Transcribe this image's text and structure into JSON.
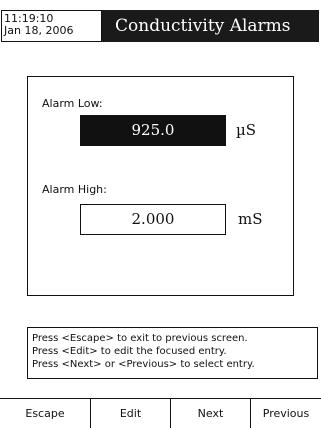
{
  "header": {
    "time": "11:19:10",
    "date": "Jan 18, 2006",
    "title": "Conductivity Alarms"
  },
  "alarms": {
    "low": {
      "label": "Alarm Low:",
      "value": "925.0",
      "unit": "µS",
      "focused": true
    },
    "high": {
      "label": "Alarm High:",
      "value": "2.000",
      "unit": "mS",
      "focused": false
    }
  },
  "help": {
    "lines": [
      "Press <Escape> to exit to previous screen.",
      "Press <Edit> to edit the focused entry.",
      "Press <Next> or <Previous> to select entry."
    ]
  },
  "softkeys": {
    "escape": "Escape",
    "edit": "Edit",
    "next": "Next",
    "previous": "Previous"
  },
  "colors": {
    "foreground": "#111111",
    "background": "#ffffff",
    "title_bar": "#1a1a1a"
  }
}
